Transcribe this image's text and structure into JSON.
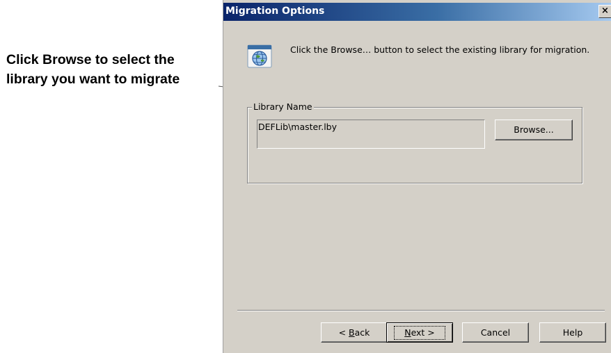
{
  "callout": {
    "line1": "Click Browse to select the",
    "line2": "library you want to migrate"
  },
  "dialog": {
    "title": "Migration Options",
    "close_glyph": "×",
    "icon": "globe-icon",
    "instruction": "Click the Browse… button to select the existing library for migration.",
    "group_label": "Library Name",
    "library_value": "DEFLib\\master.lby",
    "browse_label": "Browse...",
    "buttons": {
      "back_prefix": "< ",
      "back_mnemonic": "B",
      "back_rest": "ack",
      "next_mnemonic": "N",
      "next_rest": "ext >",
      "cancel": "Cancel",
      "help": "Help"
    }
  },
  "colors": {
    "dialog_bg": "#d4d0c8",
    "title_start": "#0a246a",
    "title_end": "#a6caf0"
  }
}
